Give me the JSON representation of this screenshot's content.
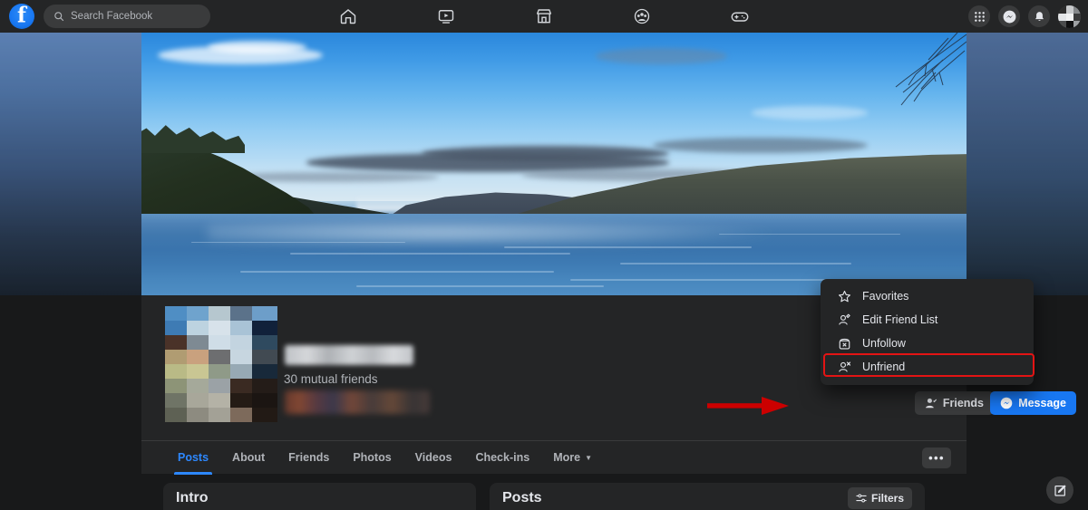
{
  "colors": {
    "brand_blue": "#1877f2",
    "accent_blue": "#2d88ff",
    "surface": "#242526",
    "page_bg": "#18191a",
    "control": "#3a3b3c",
    "text_primary": "#e4e6eb",
    "text_secondary": "#b0b3b8",
    "highlight_red": "#e31414"
  },
  "topbar": {
    "logo_name": "facebook-logo",
    "search": {
      "placeholder": "Search Facebook",
      "value": ""
    },
    "nav_items": [
      {
        "name": "home-icon",
        "label": "Home"
      },
      {
        "name": "video-icon",
        "label": "Video"
      },
      {
        "name": "marketplace-icon",
        "label": "Marketplace"
      },
      {
        "name": "groups-icon",
        "label": "Groups"
      },
      {
        "name": "gaming-icon",
        "label": "Gaming"
      }
    ],
    "right_items": [
      {
        "name": "menu-grid-icon",
        "label": "Menu"
      },
      {
        "name": "messenger-icon",
        "label": "Messenger"
      },
      {
        "name": "notifications-icon",
        "label": "Notifications"
      },
      {
        "name": "account-avatar",
        "label": "Account"
      }
    ]
  },
  "profile": {
    "name": "",
    "mutual_friends": "30 mutual friends",
    "friends_button": "Friends",
    "message_button": "Message",
    "more_button": "•••"
  },
  "tabs": [
    {
      "label": "Posts",
      "active": true
    },
    {
      "label": "About",
      "active": false
    },
    {
      "label": "Friends",
      "active": false
    },
    {
      "label": "Photos",
      "active": false
    },
    {
      "label": "Videos",
      "active": false
    },
    {
      "label": "Check-ins",
      "active": false
    },
    {
      "label": "More",
      "active": false
    }
  ],
  "friend_menu": {
    "items": [
      {
        "label": "Favorites",
        "icon": "star-icon",
        "highlighted": false
      },
      {
        "label": "Edit Friend List",
        "icon": "person-edit-icon",
        "highlighted": false
      },
      {
        "label": "Unfollow",
        "icon": "unfollow-icon",
        "highlighted": false
      },
      {
        "label": "Unfriend",
        "icon": "person-remove-icon",
        "highlighted": true
      }
    ]
  },
  "cards": {
    "intro_title": "Intro",
    "posts_title": "Posts",
    "filters_label": "Filters"
  },
  "compose": {
    "name": "compose-icon",
    "label": "Create post"
  },
  "annotations": {
    "arrow": {
      "name": "red-arrow-annotation",
      "points_to": "Friends"
    },
    "box": {
      "name": "red-highlight-box",
      "surrounds": "Unfriend"
    }
  }
}
